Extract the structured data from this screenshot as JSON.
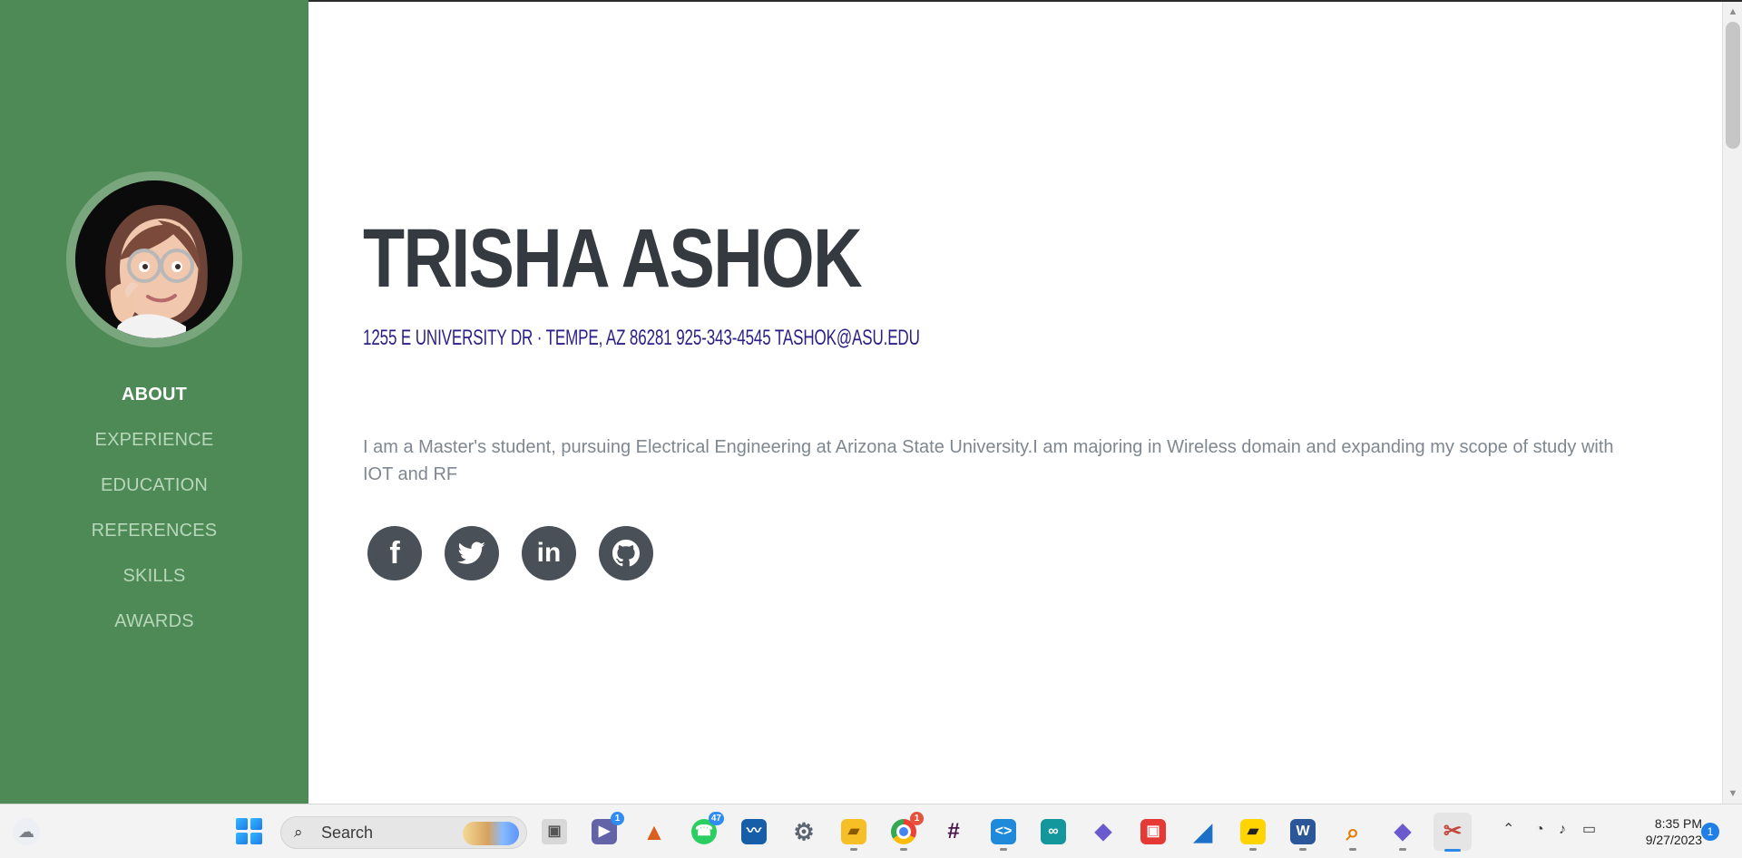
{
  "sidebar": {
    "colors": {
      "background": "#4e8a55",
      "avatar_ring": "#79a67d",
      "active_text": "#ffffff",
      "inactive_text": "#b9d7bb"
    },
    "nav_items": [
      {
        "label": "ABOUT",
        "active": true
      },
      {
        "label": "EXPERIENCE",
        "active": false
      },
      {
        "label": "EDUCATION",
        "active": false
      },
      {
        "label": "REFERENCES",
        "active": false
      },
      {
        "label": "SKILLS",
        "active": false
      },
      {
        "label": "AWARDS",
        "active": false
      }
    ]
  },
  "profile": {
    "name": "TRISHA ASHOK",
    "contact_line": "1255 E UNIVERSITY DR · TEMPE, AZ 86281 925-343-4545 TASHOK@ASU.EDU",
    "bio": "I am a Master's student, pursuing Electrical Engineering at Arizona State University.I am majoring in Wireless domain and expanding my scope of study with IOT and RF",
    "colors": {
      "name": "#343a40",
      "contact": "#2b1f86",
      "bio": "#7f8790",
      "social_bg": "#495057"
    }
  },
  "social_links": [
    {
      "name": "facebook",
      "icon": "facebook-icon"
    },
    {
      "name": "twitter",
      "icon": "twitter-icon"
    },
    {
      "name": "linkedin",
      "icon": "linkedin-icon"
    },
    {
      "name": "github",
      "icon": "github-icon"
    }
  ],
  "taskbar": {
    "search_label": "Search",
    "time": "8:35 PM",
    "date": "9/27/2023",
    "notification_count": "1",
    "apps": [
      {
        "name": "task-view",
        "icon": "task-view-icon",
        "active": false
      },
      {
        "name": "teams",
        "icon": "teams-icon",
        "badge": "1",
        "active": false
      },
      {
        "name": "matlab",
        "icon": "matlab-icon",
        "active": false
      },
      {
        "name": "whatsapp",
        "icon": "whatsapp-icon",
        "badge": "47",
        "active": false
      },
      {
        "name": "monitor-app",
        "icon": "chart-window-icon",
        "active": false
      },
      {
        "name": "settings",
        "icon": "gear-icon",
        "active": false
      },
      {
        "name": "file-explorer",
        "icon": "folder-icon",
        "active": false
      },
      {
        "name": "chrome",
        "icon": "chrome-icon",
        "badge": "1",
        "active": false
      },
      {
        "name": "slack",
        "icon": "slack-icon",
        "active": false
      },
      {
        "name": "vscode",
        "icon": "vscode-icon",
        "active": false
      },
      {
        "name": "arduino",
        "icon": "infinity-icon",
        "active": false
      },
      {
        "name": "git-client",
        "icon": "diamond-icon",
        "active": false
      },
      {
        "name": "note-app",
        "icon": "note-icon",
        "active": false
      },
      {
        "name": "shark-app",
        "icon": "fin-icon",
        "active": false
      },
      {
        "name": "sticky-notes",
        "icon": "sticky-note-icon",
        "active": false
      },
      {
        "name": "word",
        "icon": "word-icon",
        "active": false
      },
      {
        "name": "search-tool",
        "icon": "magnifier-icon",
        "active": false
      },
      {
        "name": "git-client-2",
        "icon": "diamond-icon",
        "active": false
      },
      {
        "name": "snipping-tool",
        "icon": "scissors-icon",
        "active": true
      }
    ]
  }
}
